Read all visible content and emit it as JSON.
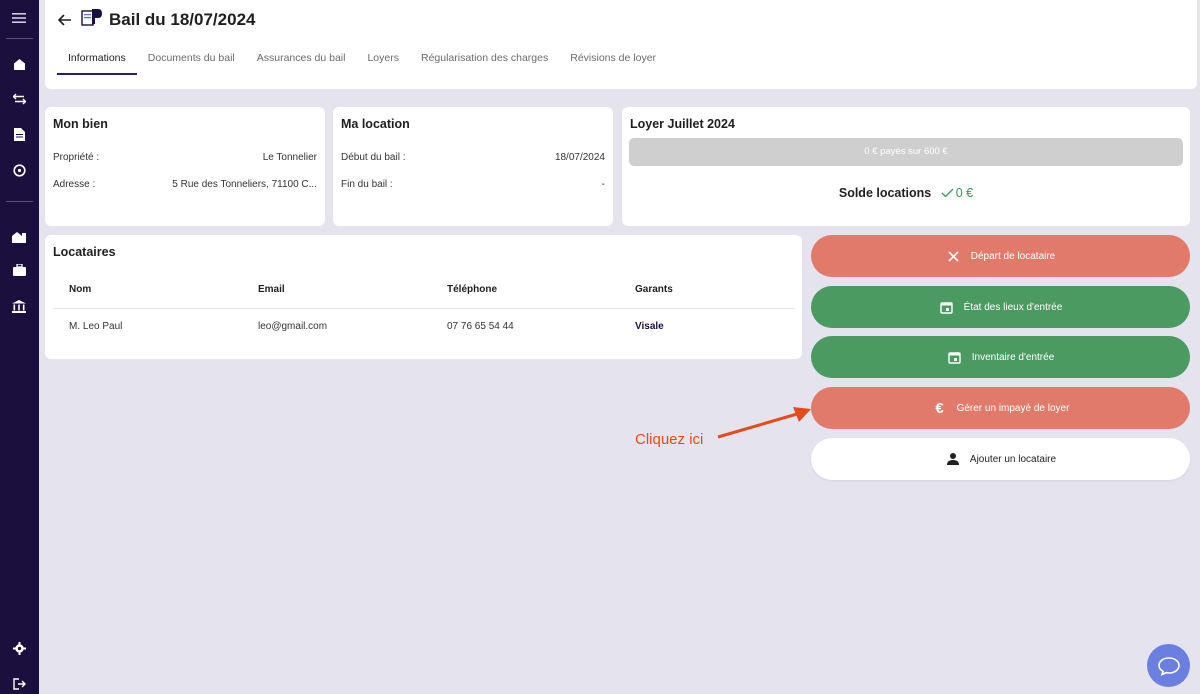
{
  "header": {
    "title": "Bail du 18/07/2024",
    "tabs": [
      {
        "label": "Informations",
        "active": true
      },
      {
        "label": "Documents du bail"
      },
      {
        "label": "Assurances du bail"
      },
      {
        "label": "Loyers"
      },
      {
        "label": "Régularisation des charges"
      },
      {
        "label": "Révisions de loyer"
      }
    ]
  },
  "mon_bien": {
    "title": "Mon bien",
    "propriete_label": "Propriété :",
    "propriete_value": "Le Tonnelier",
    "adresse_label": "Adresse :",
    "adresse_value": "5 Rue des Tonneliers, 71100 C..."
  },
  "ma_location": {
    "title": "Ma location",
    "debut_label": "Début du bail :",
    "debut_value": "18/07/2024",
    "fin_label": "Fin du bail :",
    "fin_value": "-"
  },
  "loyer": {
    "title": "Loyer Juillet 2024",
    "progress_text": "0 € payés sur 600 €",
    "progress_fraction": 0,
    "solde_label": "Solde locations",
    "solde_value": "0 €"
  },
  "locataires": {
    "title": "Locataires",
    "columns": [
      "Nom",
      "Email",
      "Téléphone",
      "Garants"
    ],
    "rows": [
      {
        "nom": "M. Leo Paul",
        "email": "leo@gmail.com",
        "telephone": "07 76 65 54 44",
        "garants": "Visale"
      }
    ]
  },
  "actions": {
    "depart": "Départ de locataire",
    "etat_lieux": "État des lieux d'entrée",
    "inventaire": "Inventaire d'entrée",
    "impaye": "Gérer un impayé de loyer",
    "ajouter": "Ajouter un locataire"
  },
  "annotation": "Cliquez ici",
  "colors": {
    "sidebar": "#1a0f3d",
    "red_action": "#e27a6b",
    "green_action": "#4a9a62",
    "annotation": "#e84b1b",
    "chat": "#6b7fe0"
  }
}
